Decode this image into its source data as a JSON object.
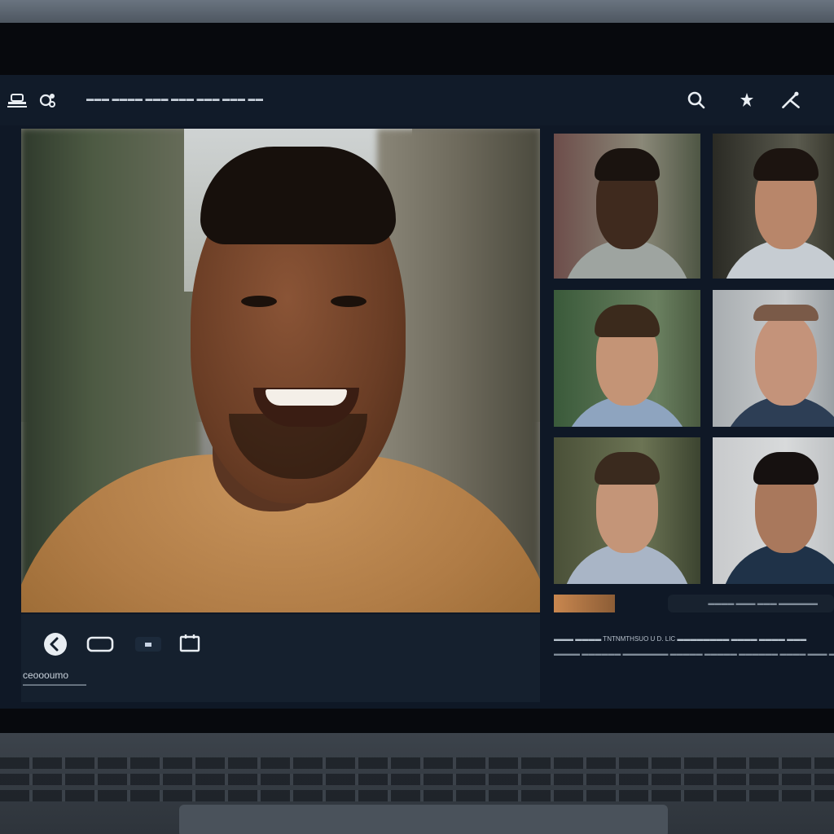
{
  "toolbar": {
    "title": "▬▬▬ ▬▬▬▬ ▬▬▬ ▬▬▬ ▬▬▬ ▬▬▬ ▬▬",
    "icons": [
      "people-icon",
      "settings-icon",
      "search-icon",
      "pin-icon",
      "tools-icon"
    ]
  },
  "controls": {
    "brand": "ceoooumo",
    "brand_sub": "▬▬▬▬▬▬▬▬▬▬▬▬▬",
    "chip_label": "▪▪"
  },
  "side_panel": {
    "strip_text": "▬▬▬▬ ▬▬▬ ▬▬▬ ▬▬▬▬▬▬",
    "line1": "▬▬▬ ▬▬▬▬ TNTNMTHSUO U D. LIC ▬▬▬▬▬▬▬▬ ▬▬▬▬ ▬▬▬▬ ▬▬▬",
    "line2": "▬▬▬▬ ▬▬▬▬▬▬ ▬▬▬▬▬▬▬ ▬▬▬▬▬ ▬▬▬▬▬ ▬▬▬▬▬▬ ▬▬▬▬ ▬▬▬ ▬▬▬▬"
  },
  "colors": {
    "screen_bg": "#0f1826",
    "toolbar_bg": "#111b29",
    "icon_color": "#e8edf2"
  }
}
